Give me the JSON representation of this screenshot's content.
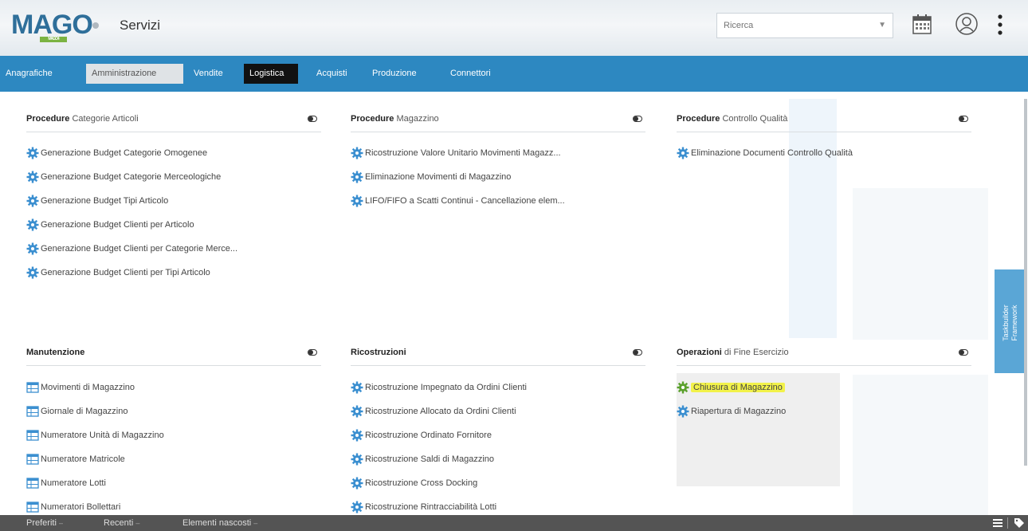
{
  "header": {
    "logo_text": "MAGO",
    "logo_sub": "MAGO4",
    "title": "Servizi",
    "search": {
      "placeholder": "Ricerca"
    },
    "icons": [
      "calendar-icon",
      "user-icon",
      "more-vertical-icon"
    ]
  },
  "nav": {
    "tabs": [
      {
        "label": "Anagrafiche"
      },
      {
        "label": "Amministrazione"
      },
      {
        "label": "Vendite"
      },
      {
        "label": "Logistica"
      },
      {
        "label": "Acquisti"
      },
      {
        "label": "Produzione"
      },
      {
        "label": "Connettori"
      }
    ],
    "active": "Logistica"
  },
  "panels": [
    {
      "title_bold": "Procedure",
      "title_rest": "Categorie Articoli",
      "items": [
        "Generazione Budget Categorie Omogenee",
        "Generazione Budget Categorie Merceologiche",
        "Generazione Budget Tipi Articolo",
        "Generazione Budget Clienti per Articolo",
        "Generazione Budget Clienti per Categorie Merce...",
        "Generazione Budget Clienti per Tipi Articolo"
      ]
    },
    {
      "title_bold": "Procedure",
      "title_rest": "Magazzino",
      "items": [
        "Ricostruzione Valore Unitario Movimenti Magazz...",
        "Eliminazione Movimenti di Magazzino",
        "LIFO/FIFO a Scatti Continui - Cancellazione elem..."
      ]
    },
    {
      "title_bold": "Procedure",
      "title_rest": "Controllo Qualità",
      "items": [
        "Eliminazione Documenti Controllo Qualità"
      ]
    },
    {
      "title_bold": "Manutenzione",
      "title_rest": "",
      "items": [
        "Movimenti di Magazzino",
        "Giornale di Magazzino",
        "Numeratore Unità di Magazzino",
        "Numeratore Matricole",
        "Numeratore Lotti",
        "Numeratori Bollettari"
      ]
    },
    {
      "title_bold": "Ricostruzioni",
      "title_rest": "",
      "items": [
        "Ricostruzione Impegnato da Ordini Clienti",
        "Ricostruzione Allocato da Ordini Clienti",
        "Ricostruzione Ordinato Fornitore",
        "Ricostruzione Saldi di Magazzino",
        "Ricostruzione Cross Docking",
        "Ricostruzione Rintracciabilità Lotti"
      ]
    },
    {
      "title_bold": "Operazioni",
      "title_rest": "di Fine Esercizio",
      "items": [
        "Chiusura di Magazzino",
        "Riapertura di Magazzino"
      ]
    }
  ],
  "side_tab": {
    "label": "Taskbuilder Framework"
  },
  "footer": {
    "items": [
      {
        "label": "Preferiti"
      },
      {
        "label": "Recenti"
      },
      {
        "label": "Elementi nascosti"
      }
    ]
  },
  "colors": {
    "nav_bg": "#2d88c1",
    "gear_blue": "#3b8fd0",
    "gear_green": "#5aa02c",
    "highlight": "#f2f24a",
    "footer_bg": "#545454"
  }
}
